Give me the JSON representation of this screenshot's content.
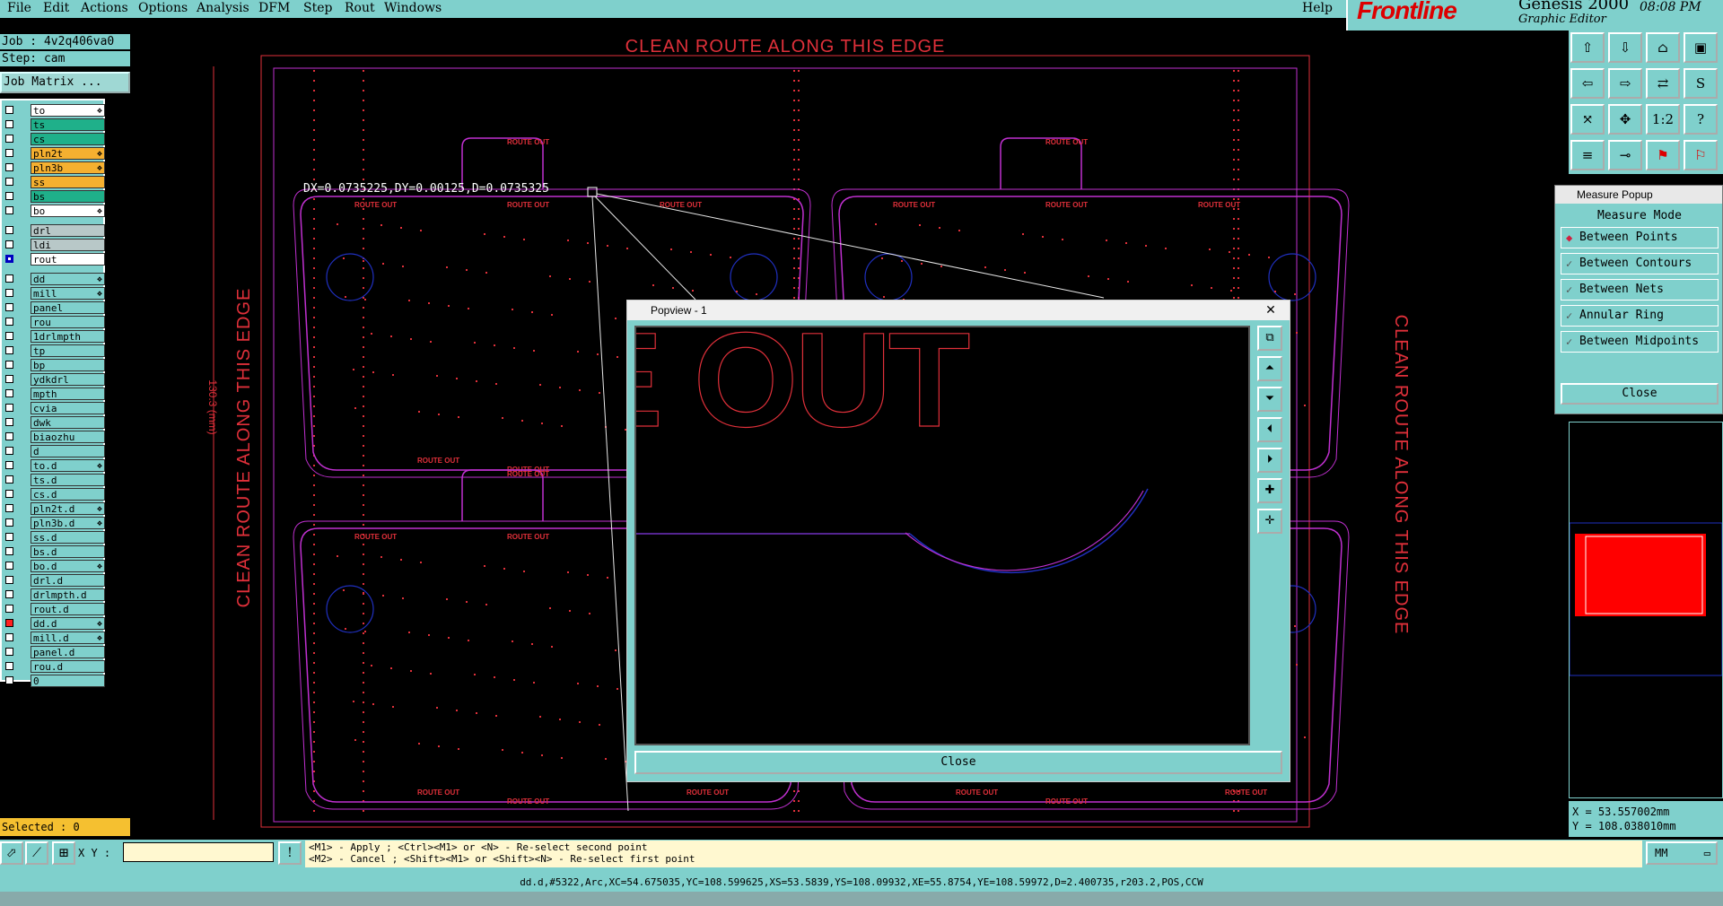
{
  "menu": {
    "items": [
      "File",
      "Edit",
      "Actions",
      "Options",
      "Analysis",
      "DFM",
      "Step",
      "Rout",
      "Windows"
    ],
    "help": "Help"
  },
  "brand": {
    "logo": "Frontline",
    "product": "Genesis 2000",
    "subtitle": "Graphic Editor",
    "time": "08:08 PM"
  },
  "job": {
    "job_label": "Job : 4v2q406va0",
    "step_label": "Step: cam",
    "matrix_button": "Job Matrix ..."
  },
  "layers": [
    {
      "name": "to",
      "color": "#ffffff",
      "icon": "❖"
    },
    {
      "name": "ts",
      "color": "#1fb08a",
      "icon": ""
    },
    {
      "name": "cs",
      "color": "#1fb08a",
      "icon": ""
    },
    {
      "name": "pln2t",
      "color": "#f5b030",
      "icon": "❖"
    },
    {
      "name": "pln3b",
      "color": "#f5b030",
      "icon": "❖"
    },
    {
      "name": "ss",
      "color": "#f5b030",
      "icon": ""
    },
    {
      "name": "bs",
      "color": "#1fb08a",
      "icon": ""
    },
    {
      "name": "bo",
      "color": "#ffffff",
      "icon": "❖"
    },
    {
      "name": "drl",
      "color": "#b8c8c8",
      "icon": ""
    },
    {
      "name": "ldi",
      "color": "#b8c8c8",
      "icon": ""
    },
    {
      "name": "rout",
      "color": "#ffffff",
      "icon": ""
    },
    {
      "name": "dd",
      "color": "#7fd0cc",
      "icon": "❖"
    },
    {
      "name": "mill",
      "color": "#7fd0cc",
      "icon": "❖"
    },
    {
      "name": "panel",
      "color": "#7fd0cc",
      "icon": ""
    },
    {
      "name": "rou",
      "color": "#7fd0cc",
      "icon": ""
    },
    {
      "name": "1drlmpth",
      "color": "#7fd0cc",
      "icon": ""
    },
    {
      "name": "tp",
      "color": "#7fd0cc",
      "icon": ""
    },
    {
      "name": "bp",
      "color": "#7fd0cc",
      "icon": ""
    },
    {
      "name": "ydkdrl",
      "color": "#7fd0cc",
      "icon": ""
    },
    {
      "name": "mpth",
      "color": "#7fd0cc",
      "icon": ""
    },
    {
      "name": "cvia",
      "color": "#7fd0cc",
      "icon": ""
    },
    {
      "name": "dwk",
      "color": "#7fd0cc",
      "icon": ""
    },
    {
      "name": "biaozhu",
      "color": "#7fd0cc",
      "icon": ""
    },
    {
      "name": "d",
      "color": "#7fd0cc",
      "icon": ""
    },
    {
      "name": "to.d",
      "color": "#7fd0cc",
      "icon": "❖"
    },
    {
      "name": "ts.d",
      "color": "#7fd0cc",
      "icon": ""
    },
    {
      "name": "cs.d",
      "color": "#7fd0cc",
      "icon": ""
    },
    {
      "name": "pln2t.d",
      "color": "#7fd0cc",
      "icon": "❖"
    },
    {
      "name": "pln3b.d",
      "color": "#7fd0cc",
      "icon": "❖"
    },
    {
      "name": "ss.d",
      "color": "#7fd0cc",
      "icon": ""
    },
    {
      "name": "bs.d",
      "color": "#7fd0cc",
      "icon": ""
    },
    {
      "name": "bo.d",
      "color": "#7fd0cc",
      "icon": "❖"
    },
    {
      "name": "drl.d",
      "color": "#7fd0cc",
      "icon": ""
    },
    {
      "name": "drlmpth.d",
      "color": "#7fd0cc",
      "icon": ""
    },
    {
      "name": "rout.d",
      "color": "#7fd0cc",
      "icon": ""
    },
    {
      "name": "dd.d",
      "color": "#7fd0cc",
      "icon": "❖"
    },
    {
      "name": "mill.d",
      "color": "#7fd0cc",
      "icon": "❖"
    },
    {
      "name": "panel.d",
      "color": "#7fd0cc",
      "icon": ""
    },
    {
      "name": "rou.d",
      "color": "#7fd0cc",
      "icon": ""
    },
    {
      "name": "0",
      "color": "#7fd0cc",
      "icon": ""
    }
  ],
  "selected_label": "Selected : 0",
  "canvas": {
    "top_text": "CLEAN ROUTE ALONG THIS EDGE",
    "left_text": "CLEAN ROUTE ALONG THIS EDGE",
    "right_text": "CLEAN ROUTE ALONG THIS EDGE",
    "dimension_text": "130.3 (mm)",
    "measure_readout": "DX=0.0735225,DY=0.00125,D=0.0735325",
    "route_label": "ROUTE OUT",
    "colors": {
      "route": "#e0303a",
      "outline": "#c030d0",
      "circle": "#2030c0"
    }
  },
  "popview": {
    "title": "Popview - 1",
    "zoom_text": "E OUT",
    "close": "Close"
  },
  "measure_popup": {
    "title": "Measure Popup",
    "mode_label": "Measure Mode",
    "options": [
      {
        "label": "Between Points",
        "active": true
      },
      {
        "label": "Between Contours",
        "active": false
      },
      {
        "label": "Between Nets",
        "active": false
      },
      {
        "label": "Annular Ring",
        "active": false
      },
      {
        "label": "Between Midpoints",
        "active": false
      }
    ],
    "close": "Close"
  },
  "coords": {
    "x": "X = 53.557002mm",
    "y": "Y = 108.038010mm"
  },
  "bottom": {
    "xy_label": "X Y :",
    "hint1": "<M1> - Apply  ; <Ctrl><M1> or <N> - Re-select second point",
    "hint2": "<M2> - Cancel ; <Shift><M1> or <Shift><N> - Re-select first point",
    "units": "MM",
    "status": "dd.d,#5322,Arc,XC=54.675035,YC=108.599625,XS=53.5839,YS=108.09932,XE=55.8754,YE=108.59972,D=2.400735,r203.2,POS,CCW"
  }
}
